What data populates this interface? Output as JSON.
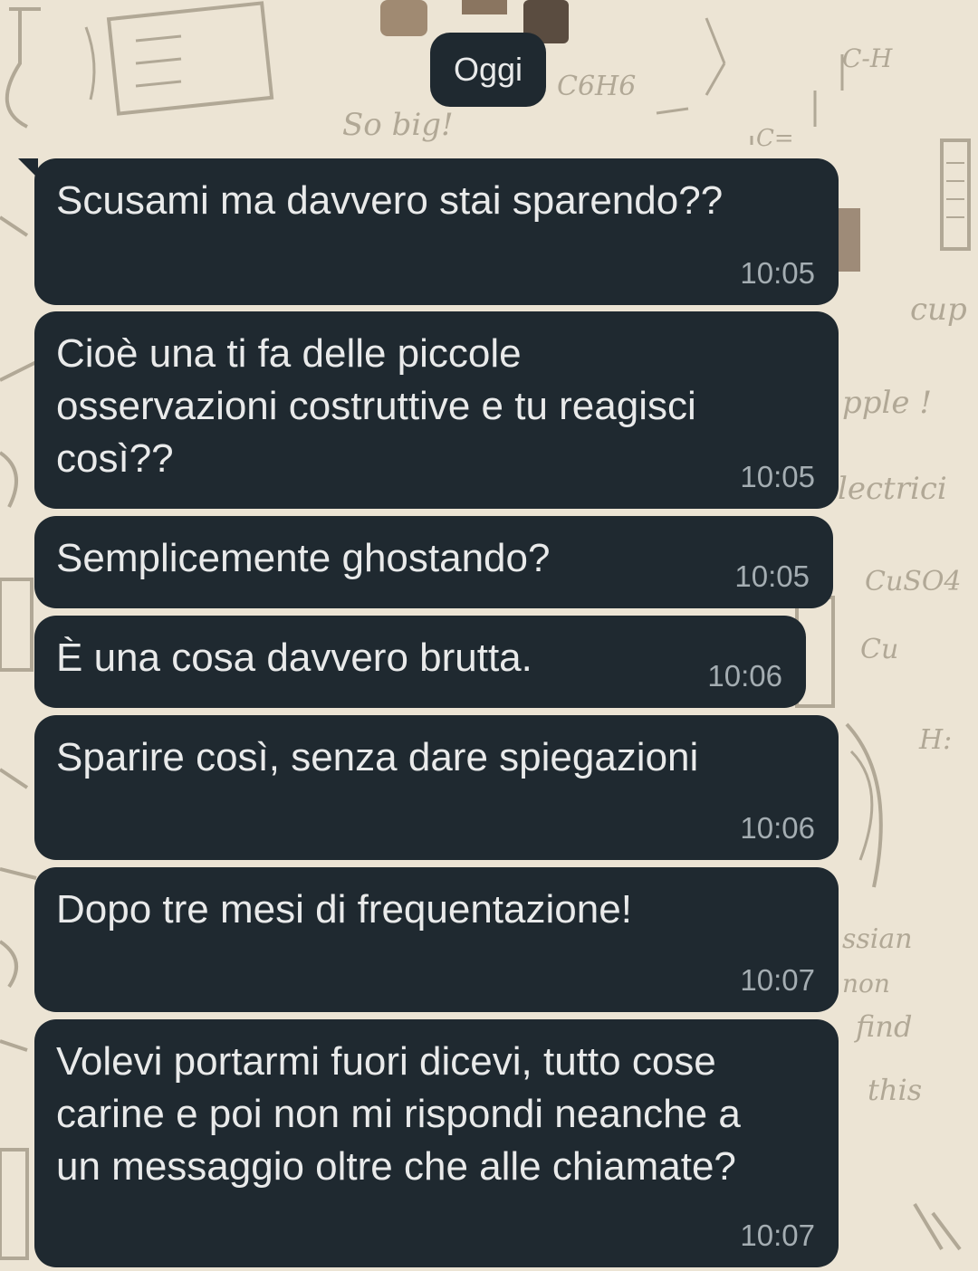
{
  "chat": {
    "date_label": "Oggi",
    "messages": [
      {
        "text": "Scusami ma davvero stai sparendo??",
        "time": "10:05"
      },
      {
        "text": "Cioè una ti fa delle piccole\nosservazioni costruttive e tu reagisci\ncosì??",
        "time": "10:05"
      },
      {
        "text": "Semplicemente ghostando?",
        "time": "10:05"
      },
      {
        "text": "È una cosa davvero brutta.",
        "time": "10:06"
      },
      {
        "text": "Sparire così, senza dare spiegazioni",
        "time": "10:06"
      },
      {
        "text": "Dopo tre mesi di frequentazione!",
        "time": "10:07"
      },
      {
        "text": "Volevi portarmi fuori dicevi, tutto cose\ncarine e poi non mi rispondi neanche a\nun messaggio oltre che alle chiamate?",
        "time": "10:07"
      }
    ]
  },
  "wallpaper": {
    "doodles": [
      "So big!",
      "C6H6",
      "C-H",
      "C=",
      "cup",
      "pple !",
      "lectrici",
      "CuSO4",
      "Cu",
      "H:",
      "ssian",
      "non",
      "find",
      "this"
    ]
  },
  "colors": {
    "bubble": "#1f2930",
    "text": "#e9eaea",
    "time": "#a4adb2",
    "wallpaper": "#ece4d4"
  }
}
